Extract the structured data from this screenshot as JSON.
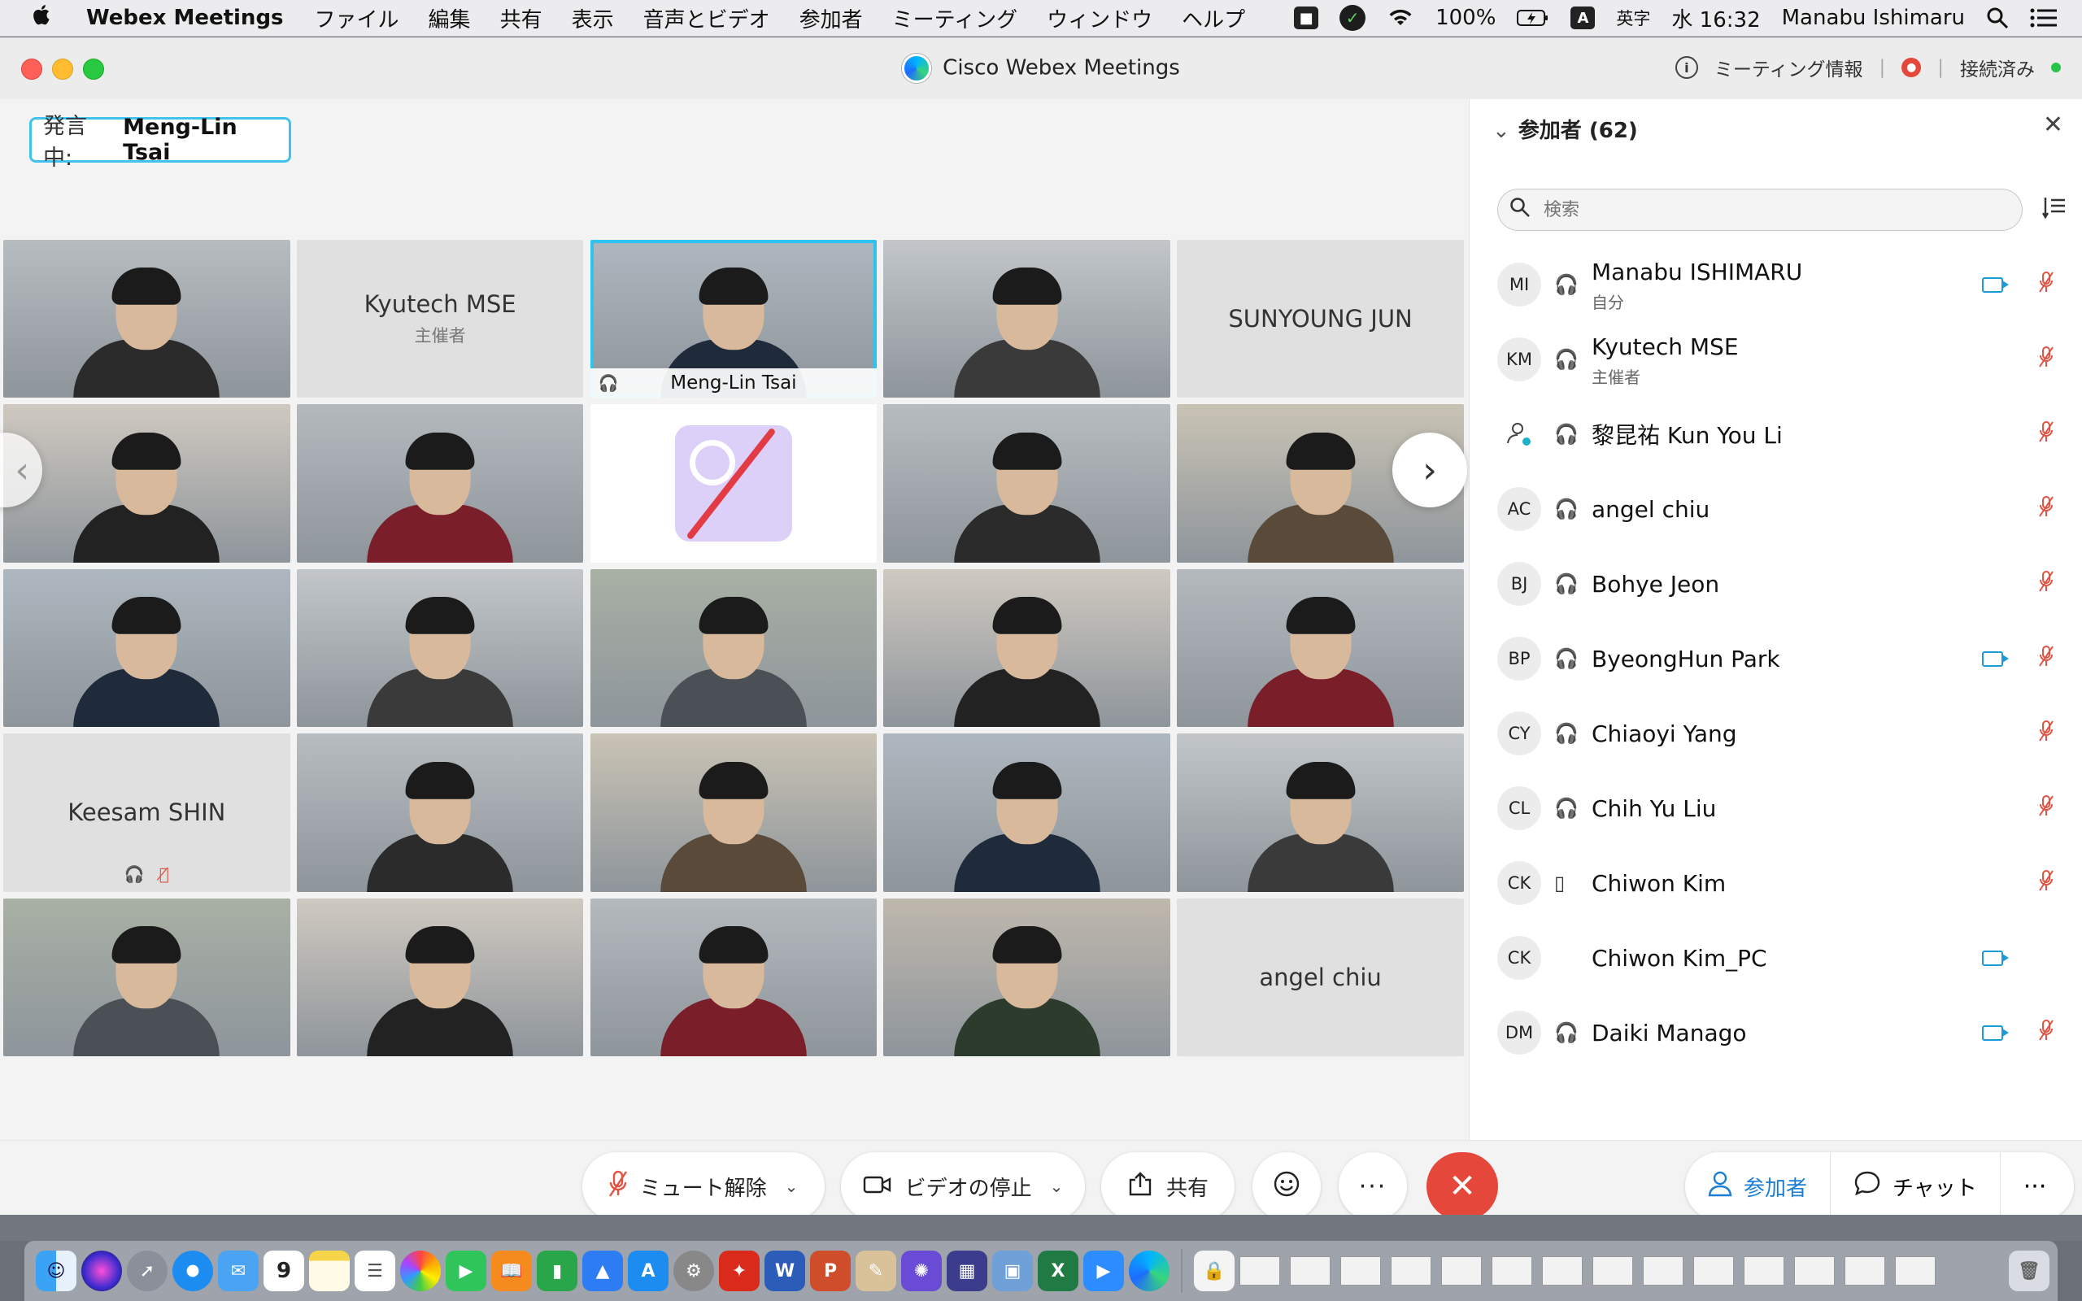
{
  "menubar": {
    "app_name": "Webex Meetings",
    "menus": [
      "ファイル",
      "編集",
      "共有",
      "表示",
      "音声とビデオ",
      "参加者",
      "ミーティング",
      "ウィンドウ",
      "ヘルプ"
    ],
    "battery": "100%",
    "input_mode_badge": "A",
    "input_mode": "英字",
    "clock": "水 16:32",
    "user": "Manabu Ishimaru"
  },
  "window": {
    "title": "Cisco Webex Meetings",
    "meeting_info": "ミーティング情報",
    "connection_status": "接続済み"
  },
  "stage": {
    "speaking_label": "発言中:",
    "speaking_name": "Meng-Lin Tsai",
    "tiles": [
      {
        "type": "video"
      },
      {
        "type": "namecard",
        "name": "Kyutech MSE",
        "role": "主催者"
      },
      {
        "type": "video",
        "label": "Meng-Lin Tsai",
        "active": true
      },
      {
        "type": "video"
      },
      {
        "type": "namecard",
        "name": "SUNYOUNG JUN"
      },
      {
        "type": "video"
      },
      {
        "type": "video"
      },
      {
        "type": "app"
      },
      {
        "type": "video"
      },
      {
        "type": "video"
      },
      {
        "type": "video"
      },
      {
        "type": "video"
      },
      {
        "type": "video"
      },
      {
        "type": "video"
      },
      {
        "type": "video"
      },
      {
        "type": "namecard",
        "name": "Keesam SHIN",
        "muted": true
      },
      {
        "type": "video"
      },
      {
        "type": "video"
      },
      {
        "type": "video"
      },
      {
        "type": "video"
      },
      {
        "type": "video"
      },
      {
        "type": "video"
      },
      {
        "type": "video"
      },
      {
        "type": "video"
      },
      {
        "type": "namecard",
        "name": "angel chiu"
      }
    ]
  },
  "panel": {
    "title": "参加者 (62)",
    "search_placeholder": "検索",
    "participants": [
      {
        "initials": "MI",
        "name": "Manabu ISHIMARU",
        "role": "自分",
        "audio": "headset",
        "video": true,
        "muted": true
      },
      {
        "initials": "KM",
        "name": "Kyutech MSE",
        "role": "主催者",
        "audio": "headset",
        "video": false,
        "muted": true
      },
      {
        "initials": "",
        "name": "黎昆祐 Kun You Li",
        "role": "",
        "audio": "headset",
        "video": false,
        "muted": true
      },
      {
        "initials": "AC",
        "name": "angel chiu",
        "role": "",
        "audio": "headset",
        "video": false,
        "muted": true
      },
      {
        "initials": "BJ",
        "name": "Bohye Jeon",
        "role": "",
        "audio": "headset",
        "video": false,
        "muted": true
      },
      {
        "initials": "BP",
        "name": "ByeongHun Park",
        "role": "",
        "audio": "headset",
        "video": true,
        "muted": true
      },
      {
        "initials": "CY",
        "name": "Chiaoyi Yang",
        "role": "",
        "audio": "headset",
        "video": false,
        "muted": true
      },
      {
        "initials": "CL",
        "name": "Chih Yu Liu",
        "role": "",
        "audio": "headset",
        "video": false,
        "muted": true
      },
      {
        "initials": "CK",
        "name": "Chiwon Kim",
        "role": "",
        "audio": "phone",
        "video": false,
        "muted": true
      },
      {
        "initials": "CK",
        "name": "Chiwon Kim_PC",
        "role": "",
        "audio": "none",
        "video": true,
        "muted": false
      },
      {
        "initials": "DM",
        "name": "Daiki Manago",
        "role": "",
        "audio": "headset",
        "video": true,
        "muted": true
      }
    ]
  },
  "controls": {
    "unmute_label": "ミュート解除",
    "video_label": "ビデオの停止",
    "share_label": "共有",
    "participants_label": "参加者",
    "chat_label": "チャット"
  },
  "dock": {
    "calendar_day": "9"
  }
}
